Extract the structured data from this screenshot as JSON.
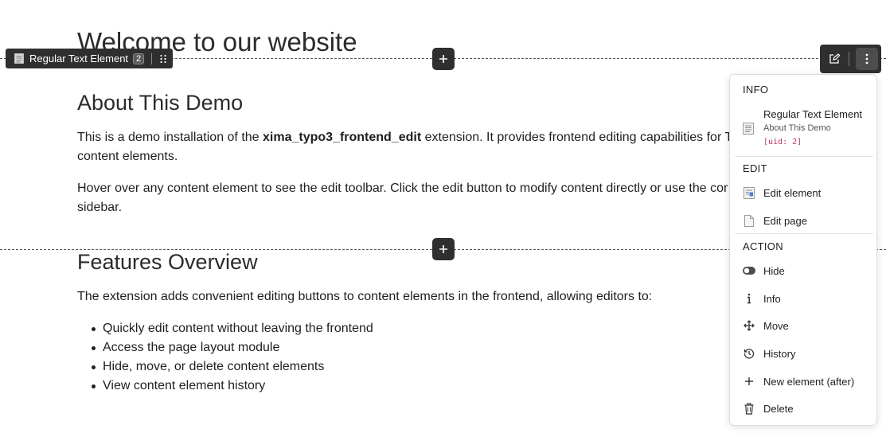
{
  "content": {
    "page_heading": "Welcome to our website",
    "section1": {
      "heading": "About This Demo",
      "para1_before": "This is a demo installation of the ",
      "para1_bold": "xima_typo3_frontend_edit",
      "para1_after": " extension. It provides frontend editing capabilities for T",
      "para1_line2": "content elements.",
      "para2_line1": "Hover over any content element to see the edit toolbar. Click the edit button to modify content directly or use the cor",
      "para2_line2": "sidebar."
    },
    "section2": {
      "heading": "Features Overview",
      "intro": "The extension adds convenient editing buttons to content elements in the frontend, allowing editors to:",
      "bullets": [
        "Quickly edit content without leaving the frontend",
        "Access the page layout module",
        "Hide, move, or delete content elements",
        "View content element history"
      ]
    }
  },
  "toolbar": {
    "element_type": "Regular Text Element",
    "uid_badge": "2",
    "icons": [
      "document-icon",
      "drag-handle-icon",
      "edit-icon",
      "more-vertical-icon",
      "plus-icon"
    ]
  },
  "menu": {
    "info_header": "INFO",
    "info_title": "Regular Text Element",
    "info_subtitle": "About This Demo",
    "info_uid": "[uid: 2]",
    "edit_header": "EDIT",
    "edit_element": "Edit element",
    "edit_page": "Edit page",
    "action_header": "ACTION",
    "actions": {
      "hide": "Hide",
      "info": "Info",
      "move": "Move",
      "history": "History",
      "new_after": "New element (after)",
      "delete": "Delete"
    }
  },
  "colors": {
    "toolbar_bg": "#2f2f2f",
    "uid_color": "#c0386a",
    "text": "#1f1f1f"
  }
}
